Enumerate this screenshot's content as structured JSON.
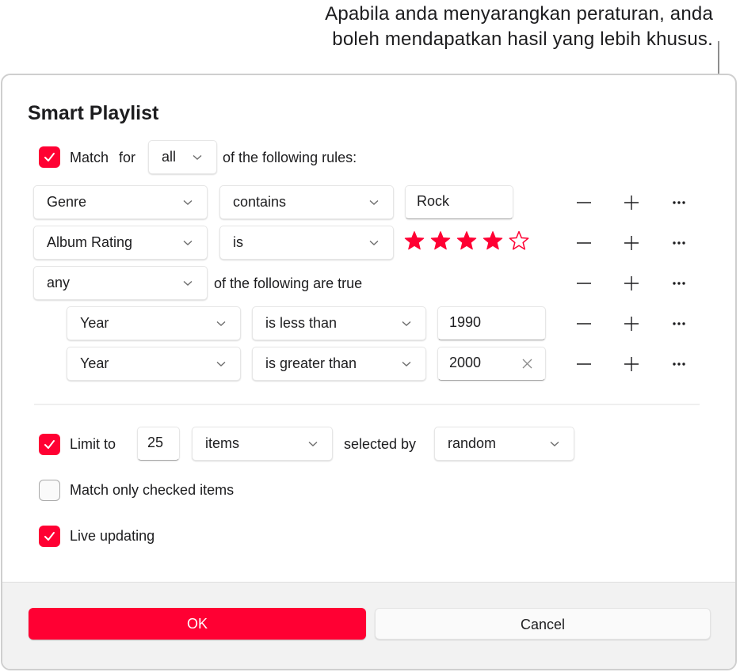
{
  "callout": {
    "line1": "Apabila anda menyarangkan peraturan, anda",
    "line2": "boleh mendapatkan hasil yang lebih khusus."
  },
  "dialog": {
    "title": "Smart Playlist",
    "match": {
      "checked": true,
      "label_match": "Match",
      "label_for": "for",
      "scope": "all",
      "suffix": "of the following rules:"
    },
    "rules": [
      {
        "field": "Genre",
        "operator": "contains",
        "value": "Rock"
      },
      {
        "field": "Album Rating",
        "operator": "is",
        "rating": 4,
        "rating_max": 5
      }
    ],
    "nested": {
      "scope": "any",
      "suffix": "of the following are true",
      "rules": [
        {
          "field": "Year",
          "operator": "is less than",
          "value": "1990"
        },
        {
          "field": "Year",
          "operator": "is greater than",
          "value": "2000"
        }
      ]
    },
    "controls": {
      "remove": "remove-rule",
      "add": "add-rule",
      "more": "nest-rule"
    },
    "limit": {
      "checked": true,
      "label": "Limit to",
      "value": "25",
      "unit": "items",
      "selected_by_label": "selected by",
      "selected_by": "random"
    },
    "match_checked": {
      "checked": false,
      "label": "Match only checked items"
    },
    "live_updating": {
      "checked": true,
      "label": "Live updating"
    },
    "buttons": {
      "ok": "OK",
      "cancel": "Cancel"
    }
  },
  "colors": {
    "accent": "#ff0033",
    "text": "#1d1d1f",
    "footer_bg": "#f2f2f2"
  }
}
